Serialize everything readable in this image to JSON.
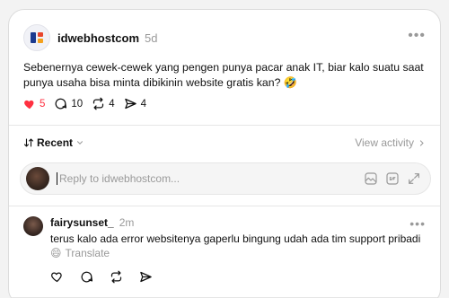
{
  "post": {
    "username": "idwebhostcom",
    "time": "5d",
    "more_icon": "•••",
    "text": "Sebenernya cewek-cewek yang pengen punya pacar anak IT, biar kalo suatu saat punya usaha bisa minta dibikinin website gratis kan? 🤣",
    "likes": "5",
    "comments": "10",
    "reposts": "4",
    "shares": "4"
  },
  "sort": {
    "label": "Recent",
    "view_activity": "View activity"
  },
  "reply": {
    "placeholder": "Reply to idwebhostcom..."
  },
  "comment": {
    "username": "fairysunset_",
    "time": "2m",
    "more_icon": "•••",
    "text": "terus kalo ada error websitenya gaperlu bingung udah ada tim support pribadi",
    "emoji": "😄",
    "translate": "Translate"
  },
  "colors": {
    "like": "#ff3040",
    "muted": "#999999"
  }
}
